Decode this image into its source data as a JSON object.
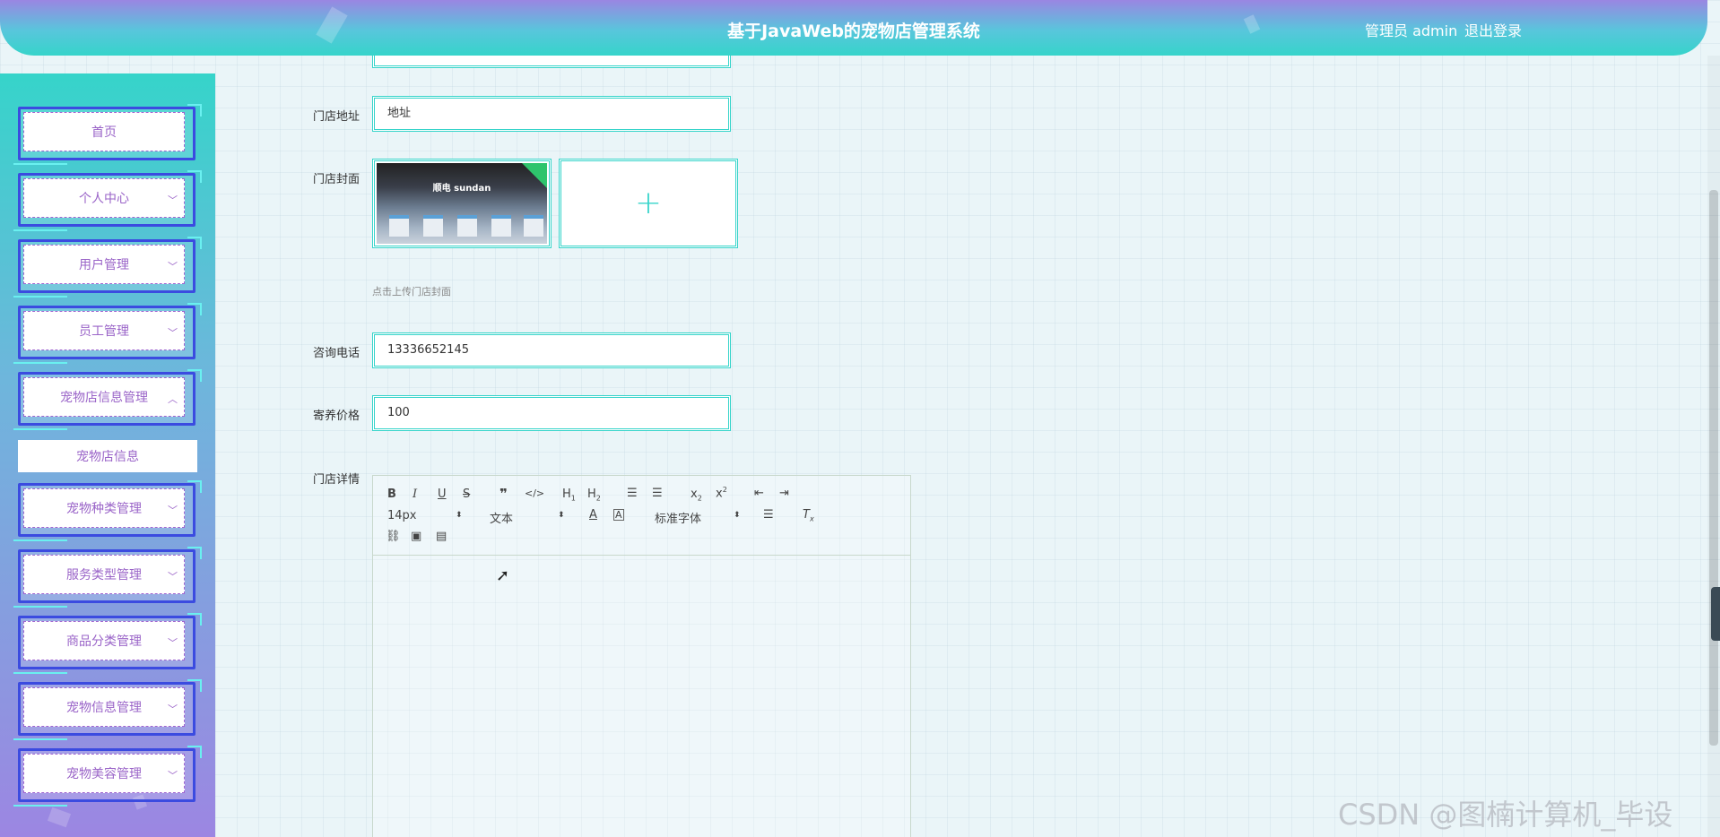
{
  "header": {
    "title": "基于JavaWeb的宠物店管理系统",
    "user_label": "管理员 admin",
    "logout_label": "退出登录"
  },
  "sidebar": {
    "items": [
      {
        "label": "首页",
        "has_chevron": false
      },
      {
        "label": "个人中心",
        "has_chevron": true,
        "chevron": "down"
      },
      {
        "label": "用户管理",
        "has_chevron": true,
        "chevron": "down"
      },
      {
        "label": "员工管理",
        "has_chevron": true,
        "chevron": "down"
      },
      {
        "label": "宠物店信息管理",
        "has_chevron": true,
        "chevron": "up"
      },
      {
        "label": "宠物种类管理",
        "has_chevron": true,
        "chevron": "down"
      },
      {
        "label": "服务类型管理",
        "has_chevron": true,
        "chevron": "down"
      },
      {
        "label": "商品分类管理",
        "has_chevron": true,
        "chevron": "down"
      },
      {
        "label": "宠物信息管理",
        "has_chevron": true,
        "chevron": "down"
      },
      {
        "label": "宠物美容管理",
        "has_chevron": true,
        "chevron": "down"
      }
    ],
    "submenu_label": "宠物店信息"
  },
  "form": {
    "address_label": "门店地址",
    "address_value": "地址",
    "cover_label": "门店封面",
    "cover_hint": "点击上传门店封面",
    "cover_photo_sign": "顺电 sundan",
    "phone_label": "咨询电话",
    "phone_value": "13336652145",
    "price_label": "寄养价格",
    "price_value": "100",
    "detail_label": "门店详情"
  },
  "editor": {
    "font_size": "14px",
    "text_style": "文本",
    "font_family": "标准字体",
    "buttons": [
      "bold-icon",
      "italic-icon",
      "underline-icon",
      "strikethrough-icon",
      "quote-icon",
      "code-icon",
      "h1-icon",
      "h2-icon",
      "ordered-list-icon",
      "bullet-list-icon",
      "subscript-icon",
      "superscript-icon",
      "outdent-icon",
      "indent-icon",
      "font-color-icon",
      "background-color-icon",
      "align-icon",
      "clear-format-icon",
      "link-icon",
      "image-icon",
      "video-icon"
    ]
  },
  "watermark": "CSDN @图楠计算机_毕设",
  "colors": {
    "accent": "#36d4ca",
    "header_top": "#9a86e2",
    "menu_border": "#3b4be0",
    "menu_text": "#9a64c8"
  }
}
